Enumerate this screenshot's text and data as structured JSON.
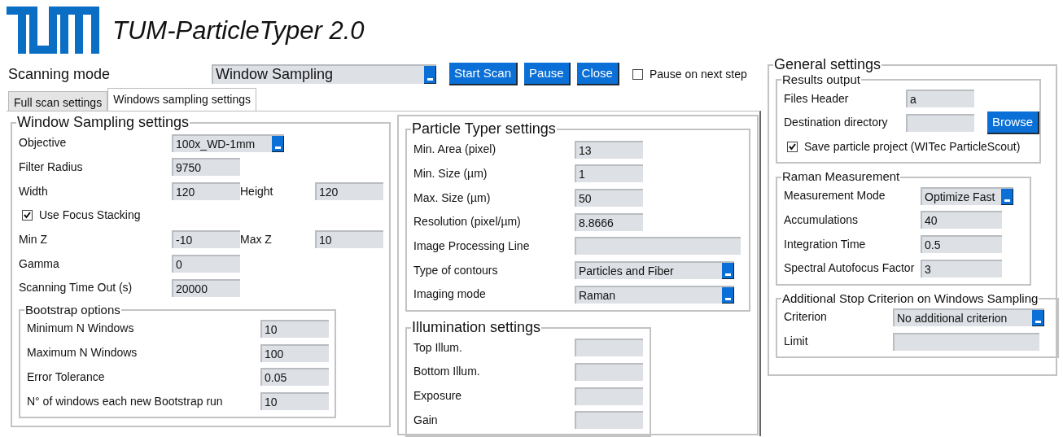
{
  "app": {
    "title": "TUM-ParticleTyper 2.0"
  },
  "toolbar": {
    "label": "Scanning mode",
    "mode": "Window Sampling",
    "buttons": [
      "Start Scan",
      "Pause",
      "Close"
    ],
    "pause": {
      "label": "Pause on next step",
      "checked": false
    }
  },
  "tabs": [
    {
      "label": "Full scan settings",
      "selected": false
    },
    {
      "label": "Windows sampling settings",
      "selected": true
    }
  ],
  "columns": [
    [
      {
        "title": "Window Sampling settings",
        "rows": [
          {
            "kind": "select",
            "label": "Objective",
            "value": "100x_WD-1mm"
          },
          {
            "kind": "text",
            "label": "Filter Radius",
            "value": "9750"
          },
          {
            "kind": "pair",
            "fields": [
              {
                "label": "Width",
                "value": "120"
              },
              {
                "label": "Height",
                "value": "120"
              }
            ]
          },
          {
            "kind": "check",
            "label": "Use Focus Stacking",
            "checked": true
          },
          {
            "kind": "pair",
            "fields": [
              {
                "label": "Min Z",
                "value": "-10"
              },
              {
                "label": "Max Z",
                "value": "10"
              }
            ]
          },
          {
            "kind": "text",
            "label": "Gamma",
            "value": "0"
          },
          {
            "kind": "text",
            "label": "Scanning Time Out (s)",
            "value": "20000"
          }
        ],
        "groups": [
          {
            "title": "Bootstrap options",
            "rows": [
              {
                "kind": "text",
                "label": "Minimum N Windows",
                "value": "10"
              },
              {
                "kind": "text",
                "label": "Maximum N Windows",
                "value": "100"
              },
              {
                "kind": "text",
                "label": "Error Tolerance",
                "value": "0.05"
              },
              {
                "kind": "text",
                "label": "N° of windows each new Bootstrap run",
                "value": "10"
              }
            ]
          }
        ]
      }
    ],
    [
      {
        "title": "Particle Typer settings",
        "rows": [
          {
            "kind": "text",
            "label": "Min. Area (pixel)",
            "value": "13"
          },
          {
            "kind": "text",
            "label": "Min. Size (µm)",
            "value": "1"
          },
          {
            "kind": "text",
            "label": "Max. Size (µm)",
            "value": "50"
          },
          {
            "kind": "text",
            "label": "Resolution (pixel/µm)",
            "value": "8.8666"
          },
          {
            "kind": "wide",
            "label": "Image Processing Line"
          },
          {
            "kind": "select",
            "label": "Type of contours",
            "value": "Particles and Fiber"
          },
          {
            "kind": "select",
            "label": "Imaging mode",
            "value": "Raman"
          }
        ]
      },
      {
        "title": "Illumination settings",
        "rows": [
          {
            "kind": "text",
            "label": "Top Illum."
          },
          {
            "kind": "text",
            "label": "Bottom Illum."
          },
          {
            "kind": "text",
            "label": "Exposure"
          },
          {
            "kind": "text",
            "label": "Gain"
          }
        ]
      }
    ]
  ],
  "general": {
    "title": "General settings",
    "groups": [
      {
        "title": "Results output",
        "rows": [
          {
            "kind": "text",
            "label": "Files Header",
            "value": "a"
          },
          {
            "kind": "browse",
            "label": "Destination directory",
            "button": "Browse"
          },
          {
            "kind": "check",
            "label": "Save particle project (WITec ParticleScout)",
            "checked": true
          }
        ]
      },
      {
        "title": "Raman Measurement",
        "rows": [
          {
            "kind": "select",
            "label": "Measurement Mode",
            "value": "Optimize Fast"
          },
          {
            "kind": "text",
            "label": "Accumulations",
            "value": "40"
          },
          {
            "kind": "text",
            "label": "Integration Time",
            "value": "0.5"
          },
          {
            "kind": "text",
            "label": "Spectral Autofocus Factor",
            "value": "3"
          }
        ]
      },
      {
        "title": "Additional Stop Criterion on Windows Sampling",
        "rows": [
          {
            "kind": "select",
            "label": "Criterion",
            "value": "No additional criterion"
          },
          {
            "kind": "wide",
            "label": "Limit"
          }
        ]
      }
    ]
  }
}
